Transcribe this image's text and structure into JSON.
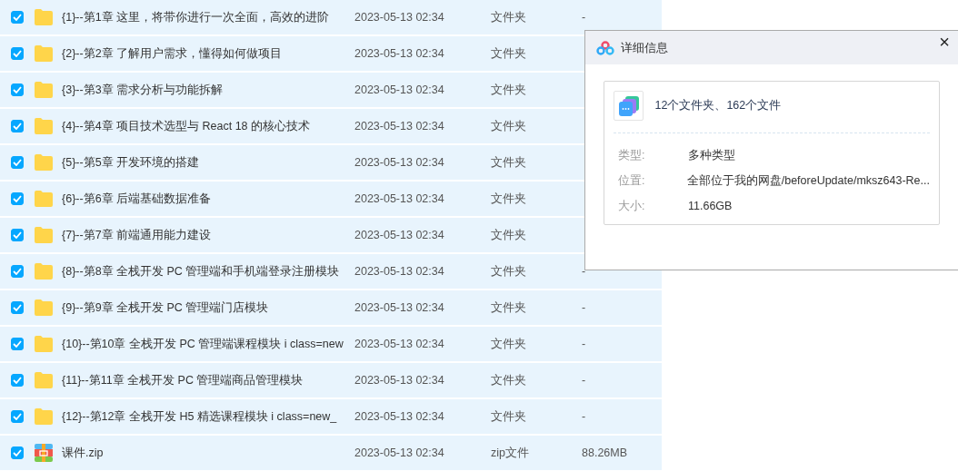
{
  "files": [
    {
      "kind": "folder",
      "name": "{1}--第1章 这里，将带你进行一次全面，高效的进阶",
      "modified": "2023-05-13 02:34",
      "type": "文件夹",
      "size": "-",
      "checked": true
    },
    {
      "kind": "folder",
      "name": "{2}--第2章 了解用户需求，懂得如何做项目",
      "modified": "2023-05-13 02:34",
      "type": "文件夹",
      "checked": true
    },
    {
      "kind": "folder",
      "name": "{3}--第3章 需求分析与功能拆解",
      "modified": "2023-05-13 02:34",
      "type": "文件夹",
      "checked": true
    },
    {
      "kind": "folder",
      "name": "{4}--第4章 项目技术选型与 React 18 的核心技术",
      "modified": "2023-05-13 02:34",
      "type": "文件夹",
      "checked": true
    },
    {
      "kind": "folder",
      "name": "{5}--第5章 开发环境的搭建",
      "modified": "2023-05-13 02:34",
      "type": "文件夹",
      "checked": true
    },
    {
      "kind": "folder",
      "name": "{6}--第6章 后端基础数据准备",
      "modified": "2023-05-13 02:34",
      "type": "文件夹",
      "checked": true
    },
    {
      "kind": "folder",
      "name": "{7}--第7章 前端通用能力建设",
      "modified": "2023-05-13 02:34",
      "type": "文件夹",
      "checked": true
    },
    {
      "kind": "folder",
      "name": "{8}--第8章 全栈开发 PC 管理端和手机端登录注册模块",
      "modified": "2023-05-13 02:34",
      "type": "文件夹",
      "size": "-",
      "checked": true
    },
    {
      "kind": "folder",
      "name": "{9}--第9章 全栈开发 PC 管理端门店模块",
      "modified": "2023-05-13 02:34",
      "type": "文件夹",
      "size": "-",
      "checked": true
    },
    {
      "kind": "folder",
      "name": "{10}--第10章 全栈开发 PC 管理端课程模块 i class=new",
      "modified": "2023-05-13 02:34",
      "type": "文件夹",
      "size": "-",
      "checked": true
    },
    {
      "kind": "folder",
      "name": "{11}--第11章 全栈开发 PC 管理端商品管理模块",
      "modified": "2023-05-13 02:34",
      "type": "文件夹",
      "size": "-",
      "checked": true
    },
    {
      "kind": "folder",
      "name": "{12}--第12章 全栈开发 H5 精选课程模块 i class=new_",
      "modified": "2023-05-13 02:34",
      "type": "文件夹",
      "size": "-",
      "checked": true
    },
    {
      "kind": "zip",
      "name": "课件.zip",
      "modified": "2023-05-13 02:34",
      "type": "zip文件",
      "size": "88.26MB",
      "checked": true
    }
  ],
  "dialog": {
    "title": "详细信息",
    "close": "×",
    "summary": "12个文件夹、162个文件",
    "properties": [
      {
        "label": "类型:",
        "value": "多种类型"
      },
      {
        "label": "位置:",
        "value": "全部位于我的网盘/beforeUpdate/mksz643-Re..."
      },
      {
        "label": "大小:",
        "value": "11.66GB"
      }
    ]
  }
}
